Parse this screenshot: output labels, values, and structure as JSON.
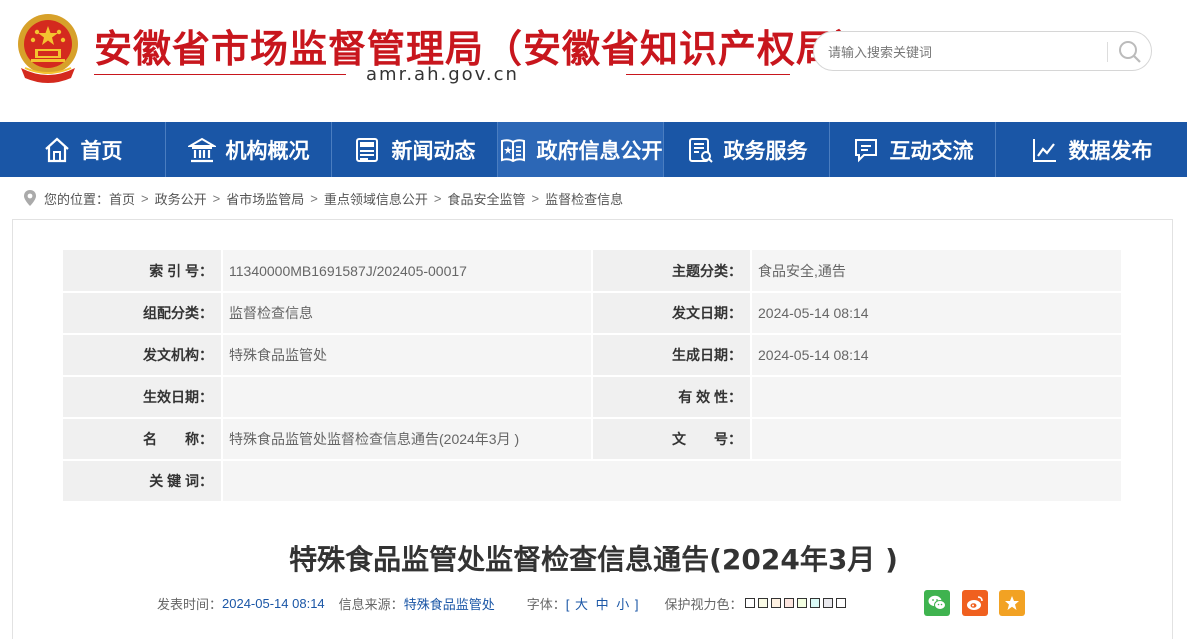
{
  "header": {
    "site_title": "安徽省市场监督管理局（安徽省知识产权局）",
    "domain": "amr.ah.gov.cn",
    "search_placeholder": "请输入搜索关键词"
  },
  "nav": {
    "items": [
      {
        "label": "首页",
        "icon": "home-icon"
      },
      {
        "label": "机构概况",
        "icon": "building-icon"
      },
      {
        "label": "新闻动态",
        "icon": "news-icon"
      },
      {
        "label": "政府信息公开",
        "icon": "gov-info-icon",
        "active": true
      },
      {
        "label": "政务服务",
        "icon": "service-icon"
      },
      {
        "label": "互动交流",
        "icon": "chat-icon"
      },
      {
        "label": "数据发布",
        "icon": "chart-icon"
      }
    ]
  },
  "breadcrumb": {
    "prefix": "您的位置：",
    "items": [
      "首页",
      "政务公开",
      "省市场监管局",
      "重点领域信息公开",
      "食品安全监管",
      "监督检查信息"
    ]
  },
  "meta": {
    "rows": [
      {
        "k1": "索 引 号：",
        "v1": "11340000MB1691587J/202405-00017",
        "k2": "主题分类：",
        "v2": "食品安全,通告"
      },
      {
        "k1": "组配分类：",
        "v1": "监督检查信息",
        "k2": "发文日期：",
        "v2": "2024-05-14 08:14"
      },
      {
        "k1": "发文机构：",
        "v1": "特殊食品监管处",
        "k2": "生成日期：",
        "v2": "2024-05-14 08:14"
      },
      {
        "k1": "生效日期：",
        "v1": "",
        "k2": "有 效 性：",
        "v2": ""
      },
      {
        "k1": "名　　称：",
        "v1": "特殊食品监管处监督检查信息通告(2024年3月 )",
        "k2": "文　　号：",
        "v2": ""
      },
      {
        "k1": "关 键 词：",
        "v1": ""
      }
    ]
  },
  "article": {
    "title": "特殊食品监管处监督检查信息通告(2024年3月 )",
    "publish_label": "发表时间：",
    "publish_time": "2024-05-14 08:14",
    "source_label": "信息来源：",
    "source": "特殊食品监管处",
    "font_label": "字体：",
    "font_open": "[",
    "font_large": "大",
    "font_medium": "中",
    "font_small": "小",
    "font_close": "]",
    "eye_label": "保护视力色："
  },
  "colors": {
    "brand_red": "#c8161d",
    "nav_blue": "#1a56a6",
    "swatches": [
      "#ffffff",
      "#fafbe6",
      "#fff2e2",
      "#fde6e0",
      "#f3ffe1",
      "#dafaf6",
      "#eaeaef",
      "#ffffff"
    ]
  }
}
